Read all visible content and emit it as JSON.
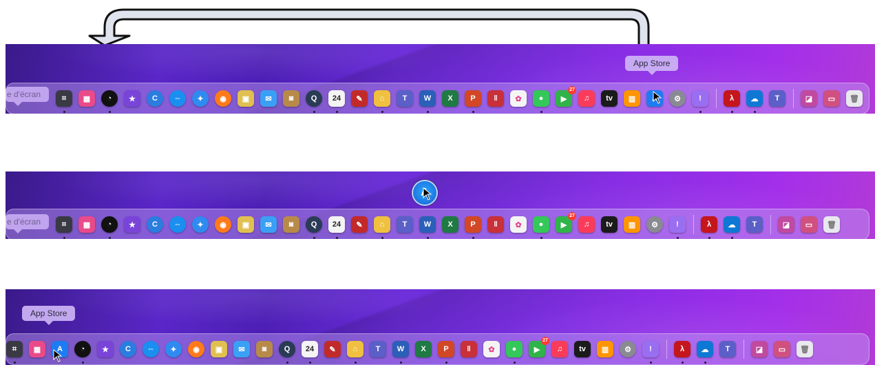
{
  "panel1": {
    "tooltip_right": "App Store",
    "tooltip_left": "e d'écran"
  },
  "panel2": {
    "tooltip_left": "e d'écran",
    "drag_icon_glyph": "A"
  },
  "panel3": {
    "tooltip_left": "App Store"
  },
  "icons": [
    {
      "name": "screenshot-icon",
      "glyph": "⌗",
      "bg": "#3a3a44"
    },
    {
      "name": "launchpad-icon",
      "glyph": "▦",
      "bg": "#e84a8a"
    },
    {
      "name": "speedtest-icon",
      "glyph": "◔",
      "bg": "#111111",
      "round": true
    },
    {
      "name": "imovie-icon",
      "glyph": "★",
      "bg": "#7a44d8"
    },
    {
      "name": "ccleaner-icon",
      "glyph": "C",
      "bg": "#2b7de0",
      "round": true
    },
    {
      "name": "teamviewer-icon",
      "glyph": "⇔",
      "bg": "#1a8ff0",
      "round": true
    },
    {
      "name": "safari-icon",
      "glyph": "✦",
      "bg": "#2f8bf0",
      "round": true
    },
    {
      "name": "firefox-icon",
      "glyph": "◉",
      "bg": "#ff7a1a",
      "round": true
    },
    {
      "name": "preview-icon",
      "glyph": "▣",
      "bg": "#e0c050"
    },
    {
      "name": "mail-icon",
      "glyph": "✉",
      "bg": "#3aa0f5"
    },
    {
      "name": "contacts-icon",
      "glyph": "◙",
      "bg": "#b88a4a"
    },
    {
      "name": "quicktime-icon",
      "glyph": "Q",
      "bg": "#2a3b55",
      "round": true
    },
    {
      "name": "calendar-icon",
      "glyph": "24",
      "bg": "#f4f4f4",
      "fg": "#222"
    },
    {
      "name": "drawing-app-icon",
      "glyph": "✎",
      "bg": "#c22a2a"
    },
    {
      "name": "home-app-icon",
      "glyph": "⌂",
      "bg": "#f0c040"
    },
    {
      "name": "teams-icon-1",
      "glyph": "T",
      "bg": "#5b5fc7"
    },
    {
      "name": "word-icon",
      "glyph": "W",
      "bg": "#2b5fb8"
    },
    {
      "name": "excel-icon",
      "glyph": "X",
      "bg": "#1f7a43"
    },
    {
      "name": "powerpoint-icon",
      "glyph": "P",
      "bg": "#d24726"
    },
    {
      "name": "parallels-icon",
      "glyph": "‖",
      "bg": "#c8303a"
    },
    {
      "name": "photos-icon",
      "glyph": "✿",
      "bg": "#f4f4f4",
      "fg": "#e0468a"
    },
    {
      "name": "messages-icon",
      "glyph": "●",
      "bg": "#34c759"
    },
    {
      "name": "facetime-icon",
      "glyph": "▶",
      "bg": "#30b44a",
      "badge": "27"
    },
    {
      "name": "music-icon",
      "glyph": "♫",
      "bg": "#fa3c5a"
    },
    {
      "name": "apple-tv-icon",
      "glyph": "tv",
      "bg": "#1b1b1b"
    },
    {
      "name": "books-icon",
      "glyph": "▥",
      "bg": "#ff9500"
    },
    {
      "name": "app-store-icon",
      "glyph": "A",
      "bg": "#1e7cf2"
    },
    {
      "name": "system-preferences-icon",
      "glyph": "⚙",
      "bg": "#8a8a92",
      "round": true
    },
    {
      "name": "feedback-icon",
      "glyph": "!",
      "bg": "#9a6ef0"
    },
    {
      "name": "sep"
    },
    {
      "name": "acrobat-icon",
      "glyph": "λ",
      "bg": "#c4161c"
    },
    {
      "name": "onedrive-icon",
      "glyph": "☁",
      "bg": "#0e78d4"
    },
    {
      "name": "teams-icon-2",
      "glyph": "T",
      "bg": "#5b5fc7"
    },
    {
      "name": "sep"
    },
    {
      "name": "downloads-stack-icon",
      "glyph": "◪",
      "bg": "#c04aa0"
    },
    {
      "name": "documents-stack-icon",
      "glyph": "▭",
      "bg": "#d05080"
    },
    {
      "name": "trash-icon",
      "glyph": "🗑",
      "bg": "#e8e8ee",
      "fg": "#777"
    }
  ]
}
